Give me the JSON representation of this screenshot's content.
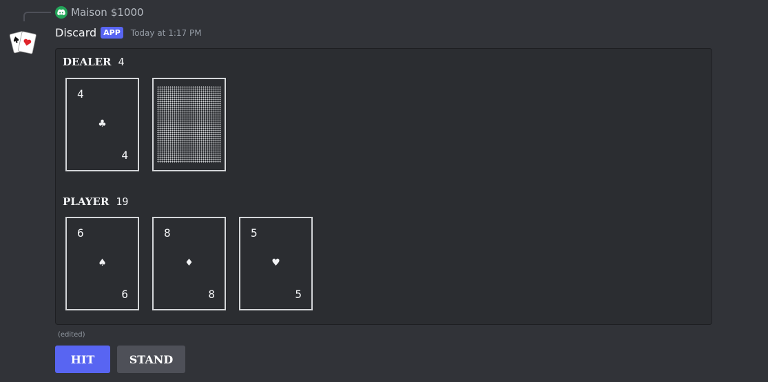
{
  "reply": {
    "name": "Maison",
    "text": "$1000",
    "avatar_icon": "discord-icon",
    "avatar_color": "#23a559"
  },
  "message": {
    "username": "Discard",
    "badge": "APP",
    "timestamp": "Today at 1:17 PM",
    "avatar_icon": "playing-cards-icon",
    "edited_label": "(edited)"
  },
  "dealer": {
    "label": "DEALER",
    "score": "4",
    "cards": [
      {
        "rank": "4",
        "suit": "♣",
        "suit_name": "clubs"
      },
      {
        "face_down": true
      }
    ]
  },
  "player": {
    "label": "PLAYER",
    "score": "19",
    "cards": [
      {
        "rank": "6",
        "suit": "♠",
        "suit_name": "spades"
      },
      {
        "rank": "8",
        "suit": "♦",
        "suit_name": "diamonds"
      },
      {
        "rank": "5",
        "suit": "♥",
        "suit_name": "hearts"
      }
    ]
  },
  "buttons": {
    "hit": "HIT",
    "stand": "STAND"
  },
  "colors": {
    "accent": "#5865f2",
    "secondary_button": "#4e5058",
    "background": "#313338",
    "embed": "#2b2d31"
  }
}
